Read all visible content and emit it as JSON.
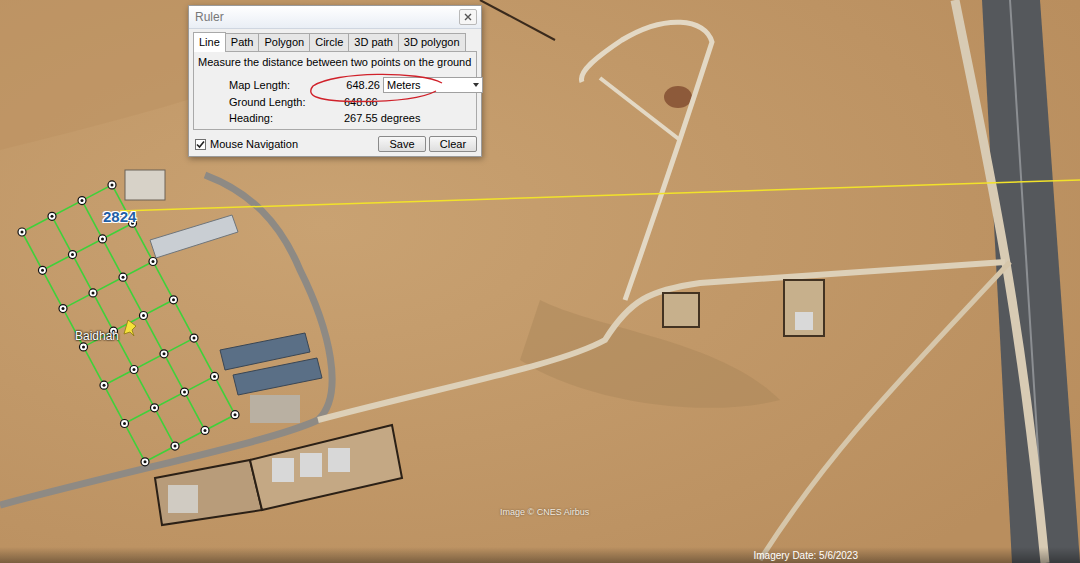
{
  "ruler": {
    "title": "Ruler",
    "tabs": [
      {
        "label": "Line",
        "selected": true
      },
      {
        "label": "Path",
        "selected": false
      },
      {
        "label": "Polygon",
        "selected": false
      },
      {
        "label": "Circle",
        "selected": false
      },
      {
        "label": "3D path",
        "selected": false
      },
      {
        "label": "3D polygon",
        "selected": false
      }
    ],
    "description": "Measure the distance between two points on the ground",
    "fields": [
      {
        "label": "Map Length:",
        "value": "648.26",
        "unit": "Meters"
      },
      {
        "label": "Ground Length:",
        "value": "648.66"
      },
      {
        "label": "Heading:",
        "value": "267.55 degrees"
      }
    ],
    "mouse_navigation": {
      "label": "Mouse Navigation",
      "checked": true
    },
    "buttons": [
      "Save",
      "Clear"
    ]
  },
  "map": {
    "labels": [
      {
        "text": "2824",
        "kind": "parcel"
      },
      {
        "text": "Baidhah",
        "kind": "place"
      }
    ],
    "attribution": "Image © CNES Airbus",
    "imagery_date": "Imagery Date: 5/6/2023"
  }
}
